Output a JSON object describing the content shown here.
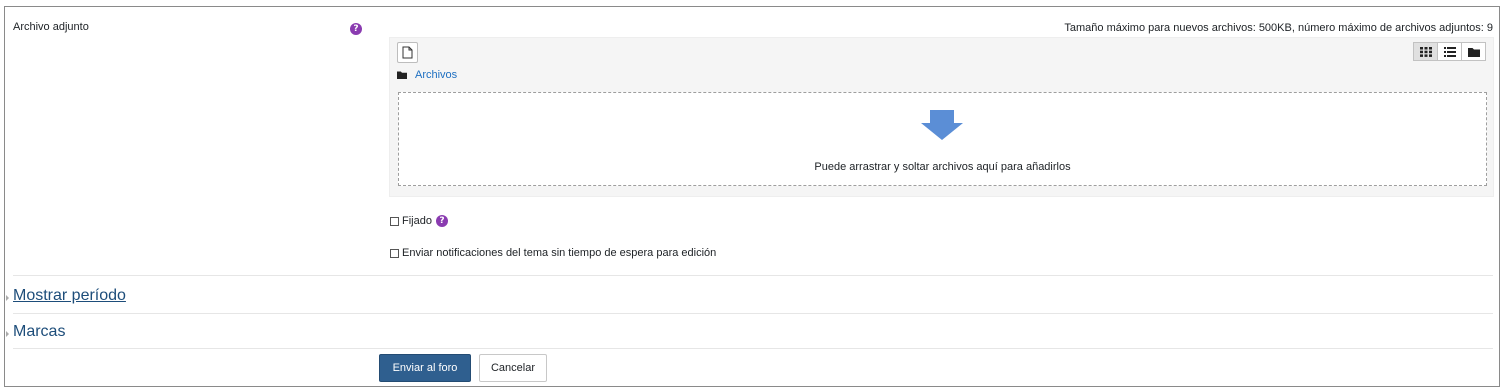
{
  "attachment": {
    "label": "Archivo adjunto",
    "help_icon": "question-circle-icon",
    "limits_text": "Tamaño máximo para nuevos archivos: 500KB, número máximo de archivos adjuntos: 9"
  },
  "filemanager": {
    "new_file_icon": "file-icon",
    "view_modes": [
      {
        "icon": "grid-icon",
        "active": true
      },
      {
        "icon": "list-icon",
        "active": false
      },
      {
        "icon": "folder-icon",
        "active": false
      }
    ],
    "path_label": "Archivos",
    "dropzone_text": "Puede arrastrar y soltar archivos aquí para añadirlos",
    "arrow_color": "#5b8ed6"
  },
  "options": {
    "pinned_label": "Fijado",
    "notify_label": "Enviar notificaciones del tema sin tiempo de espera para edición"
  },
  "sections": {
    "display_period": "Mostrar período",
    "tags": "Marcas"
  },
  "actions": {
    "submit_label": "Enviar al foro",
    "cancel_label": "Cancelar"
  },
  "colors": {
    "primary": "#2f5f8f",
    "help": "#8a3bb0",
    "link": "#1d6fc1"
  }
}
